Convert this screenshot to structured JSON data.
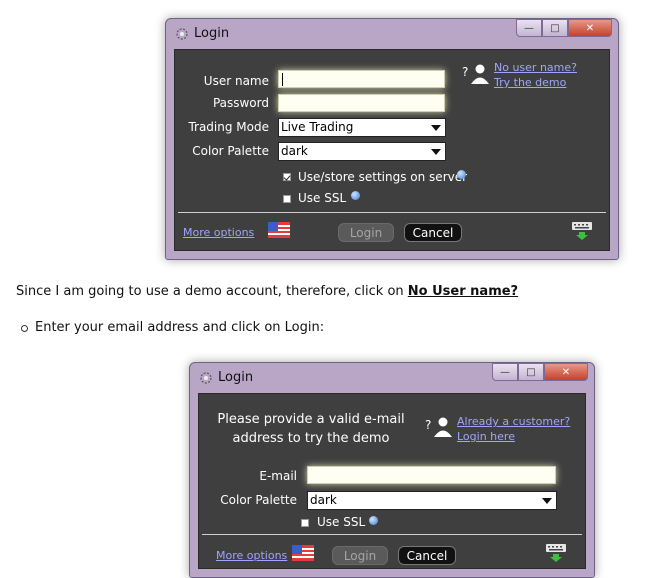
{
  "window1": {
    "title": "Login",
    "username_label": "User name",
    "username_value": "",
    "password_label": "Password",
    "password_value": "",
    "trading_mode_label": "Trading Mode",
    "trading_mode_value": "Live Trading",
    "color_palette_label": "Color Palette",
    "color_palette_value": "dark",
    "use_store_settings_label": "Use/store settings on server",
    "use_store_settings_checked": true,
    "use_ssl_label": "Use SSL",
    "use_ssl_checked": false,
    "no_user_link": "No user name?",
    "try_demo_link": "Try the demo",
    "more_options": "More options",
    "login_button": "Login",
    "cancel_button": "Cancel"
  },
  "instructions": {
    "line1_prefix": "Since I am going to use a demo account, therefore, click on ",
    "line1_link": "No User name?",
    "bullet1": "Enter your email address and click on Login:"
  },
  "window2": {
    "title": "Login",
    "prompt_line1": "Please provide a valid e-mail",
    "prompt_line2": "address to try the demo",
    "already_customer_link": "Already a customer?",
    "login_here_link": "Login here",
    "email_label": "E-mail",
    "email_value": "",
    "color_palette_label": "Color Palette",
    "color_palette_value": "dark",
    "use_ssl_label": "Use SSL",
    "use_ssl_checked": false,
    "more_options": "More options",
    "login_button": "Login",
    "cancel_button": "Cancel"
  },
  "icons": {
    "app": "app-icon",
    "user": "user-help-icon",
    "flag": "us-flag-icon",
    "keyboard": "keyboard-icon",
    "info": "info-icon"
  }
}
